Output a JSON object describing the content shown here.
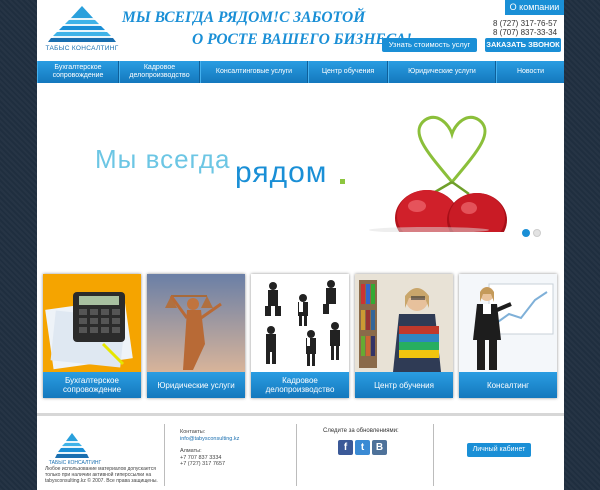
{
  "header": {
    "logo_text": "ТАБЫС КОНСАЛТИНГ",
    "slogan_line1": "МЫ ВСЕГДА РЯДОМ!С ЗАБОТОЙ",
    "slogan_line2": "О РОСТЕ ВАШЕГО БИЗНЕСА!",
    "about_label": "О компании",
    "phone1": "8 (727) 317-76-57",
    "phone2": "8 (707) 837-33-34",
    "cost_button": "Узнать стоимость услуг",
    "call_button": "ЗАКАЗАТЬ ЗВОНОК"
  },
  "nav": {
    "items": [
      {
        "label": "Бухгалтерское сопровождение"
      },
      {
        "label": "Кадровое делопроизводство"
      },
      {
        "label": "Консалтинговые услуги"
      },
      {
        "label": "Центр обучения"
      },
      {
        "label": "Юридические услуги"
      },
      {
        "label": "Новости"
      }
    ]
  },
  "banner": {
    "text_light": "Мы всегда",
    "text_bold": "рядом",
    "slides": [
      {
        "active": true
      },
      {
        "active": false
      }
    ]
  },
  "tiles": [
    {
      "label": "Бухгалтерское сопровождение",
      "image": "calculator-documents"
    },
    {
      "label": "Юридические услуги",
      "image": "themis-statue"
    },
    {
      "label": "Кадровое делопроизводство",
      "image": "business-people"
    },
    {
      "label": "Центр обучения",
      "image": "student-books"
    },
    {
      "label": "Консалтинг",
      "image": "presenter-whiteboard"
    }
  ],
  "footer": {
    "logo_text": "ТАБЫС КОНСАЛТИНГ",
    "legal": "Любое использование материалов допускается только при наличии активной гиперссылки на tabysconsulting.kz © 2007. Все права защищены.",
    "contacts_title": "Контакты:",
    "email": "info@tabysconsulting.kz",
    "city": "Алматы:",
    "phone1": "+7 707 837 3334",
    "phone2": "+7 (727) 317 7657",
    "follow_text": "Следите за обновлениями:",
    "social": [
      "f",
      "t",
      "B"
    ],
    "cabinet_button": "Личный кабинет"
  },
  "colors": {
    "accent": "#1a8fd6",
    "nav_dark": "#1478bd",
    "background": "#1f2e3f",
    "banner_light": "#6cc6e4",
    "banner_dot": "#8dc63f"
  }
}
